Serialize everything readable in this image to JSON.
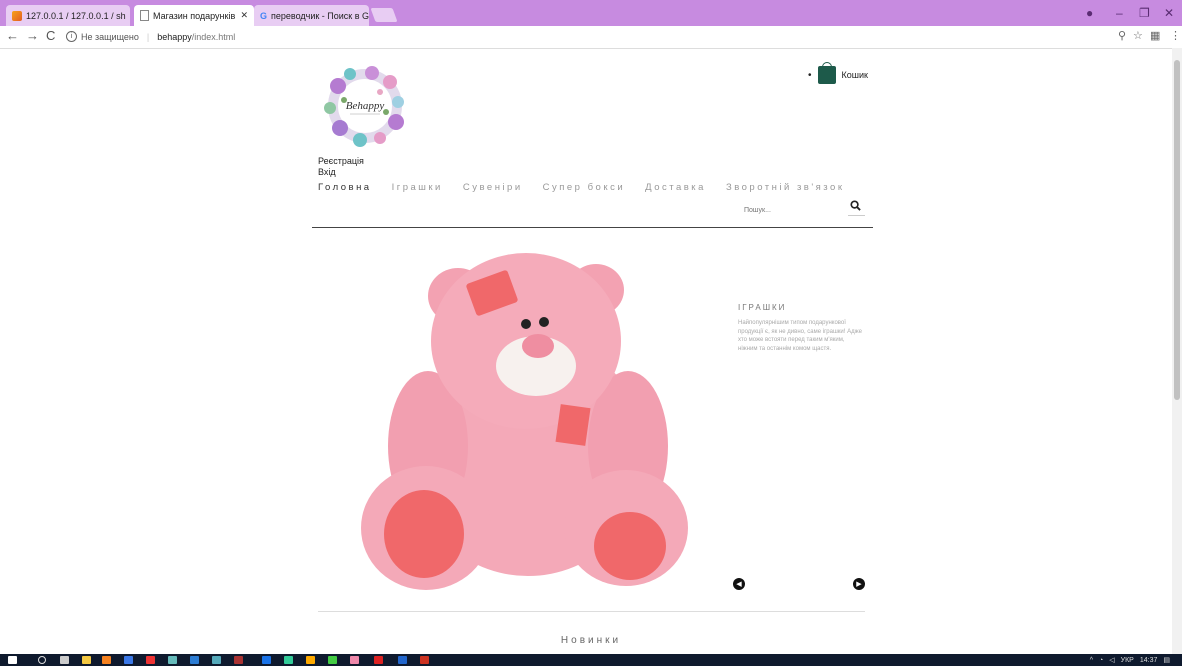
{
  "browser": {
    "tabs": [
      {
        "title": "127.0.0.1 / 127.0.0.1 / sh",
        "active": false
      },
      {
        "title": "Магазин подарунків",
        "active": true
      },
      {
        "title": "переводчик - Поиск в G",
        "active": false
      }
    ],
    "security_label": "Не защищено",
    "url_domain": "behappy",
    "url_path": "/index.html"
  },
  "header": {
    "logo_text": "Behappy",
    "cart_label": "Кошик",
    "auth": [
      "Реєстрація",
      "Вхід"
    ]
  },
  "nav": {
    "items": [
      "Головна",
      "Іграшки",
      "Сувеніри",
      "Супер бокси",
      "Доставка",
      "Зворотній зв'язок"
    ]
  },
  "search": {
    "placeholder": "Пошук..."
  },
  "slider": {
    "title": "ІГРАШКИ",
    "text": "Найпопулярнішим типом подарункової продукції є, як не дивно, саме іграшки! Адже хто може встояти перед таким м'яким, ніжним та останнім комом щастя."
  },
  "section_title": "Новинки",
  "taskbar": {
    "lang": "УКР",
    "time": "14:37"
  },
  "colors": {
    "tabbar": "#c78be0",
    "bear_pink": "#f4a3b3",
    "patch": "#f0686a",
    "cart_bag": "#1d5a4a"
  }
}
